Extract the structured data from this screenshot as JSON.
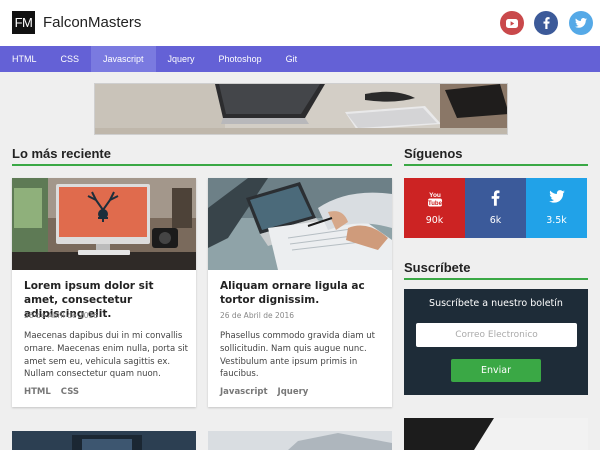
{
  "brand": {
    "mark": "FM",
    "name": "FalconMasters"
  },
  "header_social": [
    {
      "icon": "youtube-icon",
      "color": "#c9494b"
    },
    {
      "icon": "facebook-icon",
      "color": "#3c5a99"
    },
    {
      "icon": "twitter-icon",
      "color": "#55a9e7"
    }
  ],
  "nav": {
    "items": [
      "HTML",
      "CSS",
      "Javascript",
      "Jquery",
      "Photoshop",
      "Git"
    ],
    "active": "Javascript",
    "color": "#6461d6"
  },
  "sections": {
    "latest": "Lo más reciente",
    "follow": "Síguenos",
    "subscribe": "Suscríbete"
  },
  "posts": [
    {
      "title": "Lorem ipsum dolor sit amet, consectetur adipiscing elit.",
      "date": "26 de Abril de 2016",
      "excerpt": "Maecenas dapibus dui in mi convallis ornare. Maecenas enim nulla, porta sit amet sem eu, vehicula sagittis ex. Nullam consectetur quam nuon.",
      "tags": [
        "HTML",
        "CSS"
      ]
    },
    {
      "title": "Aliquam ornare ligula ac tortor dignissim.",
      "date": "26 de Abril de 2016",
      "excerpt": "Phasellus commodo gravida diam ut sollicitudin. Nam quis augue nunc. Vestibulum ante ipsum primis in faucibus.",
      "tags": [
        "Javascript",
        "Jquery"
      ]
    }
  ],
  "follow": {
    "youtube": {
      "count": "90k",
      "color": "#cc2323",
      "label": "You Tube"
    },
    "facebook": {
      "count": "6k",
      "color": "#3b5a9a"
    },
    "twitter": {
      "count": "3.5k",
      "color": "#21a2e8"
    }
  },
  "subscribe": {
    "heading": "Suscríbete a nuestro boletín",
    "placeholder": "Correo Electronico",
    "button": "Enviar"
  },
  "colors": {
    "accent_green": "#3aa845",
    "subscribe_bg": "#1e2c38"
  }
}
